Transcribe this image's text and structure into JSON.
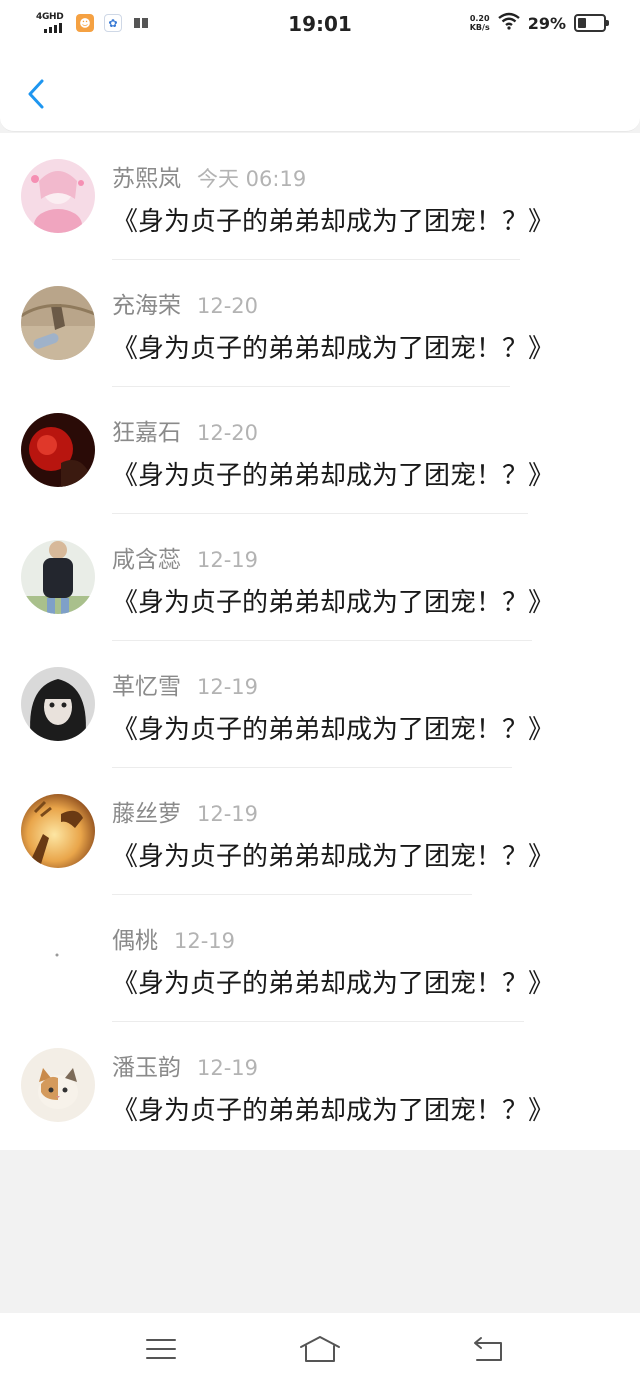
{
  "status_bar": {
    "network": "4GHD",
    "time": "19:01",
    "speed_top": "0.20",
    "speed_bottom": "KB/s",
    "battery": "29%"
  },
  "header": {
    "back_icon": "chevron-left-icon",
    "accent": "#1e96f0"
  },
  "list": {
    "items": [
      {
        "name": "苏熙岚",
        "date": "今天 06:19",
        "message": "《身为贞子的弟弟却成为了团宠！？》"
      },
      {
        "name": "充海荣",
        "date": "12-20",
        "message": "《身为贞子的弟弟却成为了团宠！？》"
      },
      {
        "name": "狂嘉石",
        "date": "12-20",
        "message": "《身为贞子的弟弟却成为了团宠！？》"
      },
      {
        "name": "咸含蕊",
        "date": "12-19",
        "message": "《身为贞子的弟弟却成为了团宠！？》"
      },
      {
        "name": "革忆雪",
        "date": "12-19",
        "message": "《身为贞子的弟弟却成为了团宠！？》"
      },
      {
        "name": "藤丝萝",
        "date": "12-19",
        "message": "《身为贞子的弟弟却成为了团宠！？》"
      },
      {
        "name": "偶桃",
        "date": "12-19",
        "message": "《身为贞子的弟弟却成为了团宠！？》"
      },
      {
        "name": "潘玉韵",
        "date": "12-19",
        "message": "《身为贞子的弟弟却成为了团宠！？》"
      }
    ]
  },
  "nav_bar": {
    "menu_icon": "menu-icon",
    "home_icon": "home-icon",
    "back_icon": "back-arrow-icon"
  }
}
